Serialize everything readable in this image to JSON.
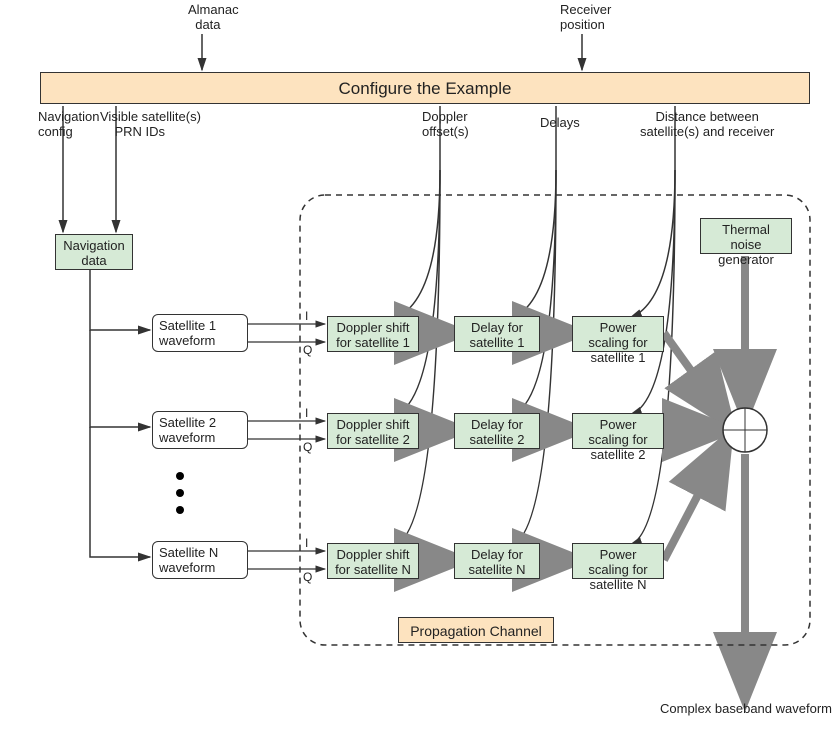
{
  "inputs": {
    "almanac": "Almanac\n  data",
    "receiver": "Receiver\nposition"
  },
  "configure": "Configure the Example",
  "outputs_from_configure": {
    "nav_config": "Navigation\nconfig",
    "visible_prn": "Visible satellite(s)\n    PRN IDs",
    "doppler": "Doppler\noffset(s)",
    "delays": "Delays",
    "distance": "Distance between\nsatellite(s) and receiver"
  },
  "nav_data": "Navigation\ndata",
  "sat_waveforms": {
    "s1": "Satellite 1\nwaveform",
    "s2": "Satellite 2\nwaveform",
    "sN": "Satellite N\nwaveform"
  },
  "iq": {
    "i": "I",
    "q": "Q"
  },
  "doppler_blocks": {
    "s1": "Doppler shift\nfor satellite 1",
    "s2": "Doppler shift\nfor satellite 2",
    "sN": "Doppler shift\nfor satellite N"
  },
  "delay_blocks": {
    "s1": "Delay\nfor satellite 1",
    "s2": "Delay\nfor satellite 2",
    "sN": "Delay\nfor satellite N"
  },
  "power_blocks": {
    "s1": "Power scaling\nfor satellite 1",
    "s2": "Power scaling\nfor satellite 2",
    "sN": "Power scaling\nfor satellite N"
  },
  "thermal": "Thermal noise\ngenerator",
  "propagation": "Propagation Channel",
  "output_label": "Complex baseband waveform"
}
